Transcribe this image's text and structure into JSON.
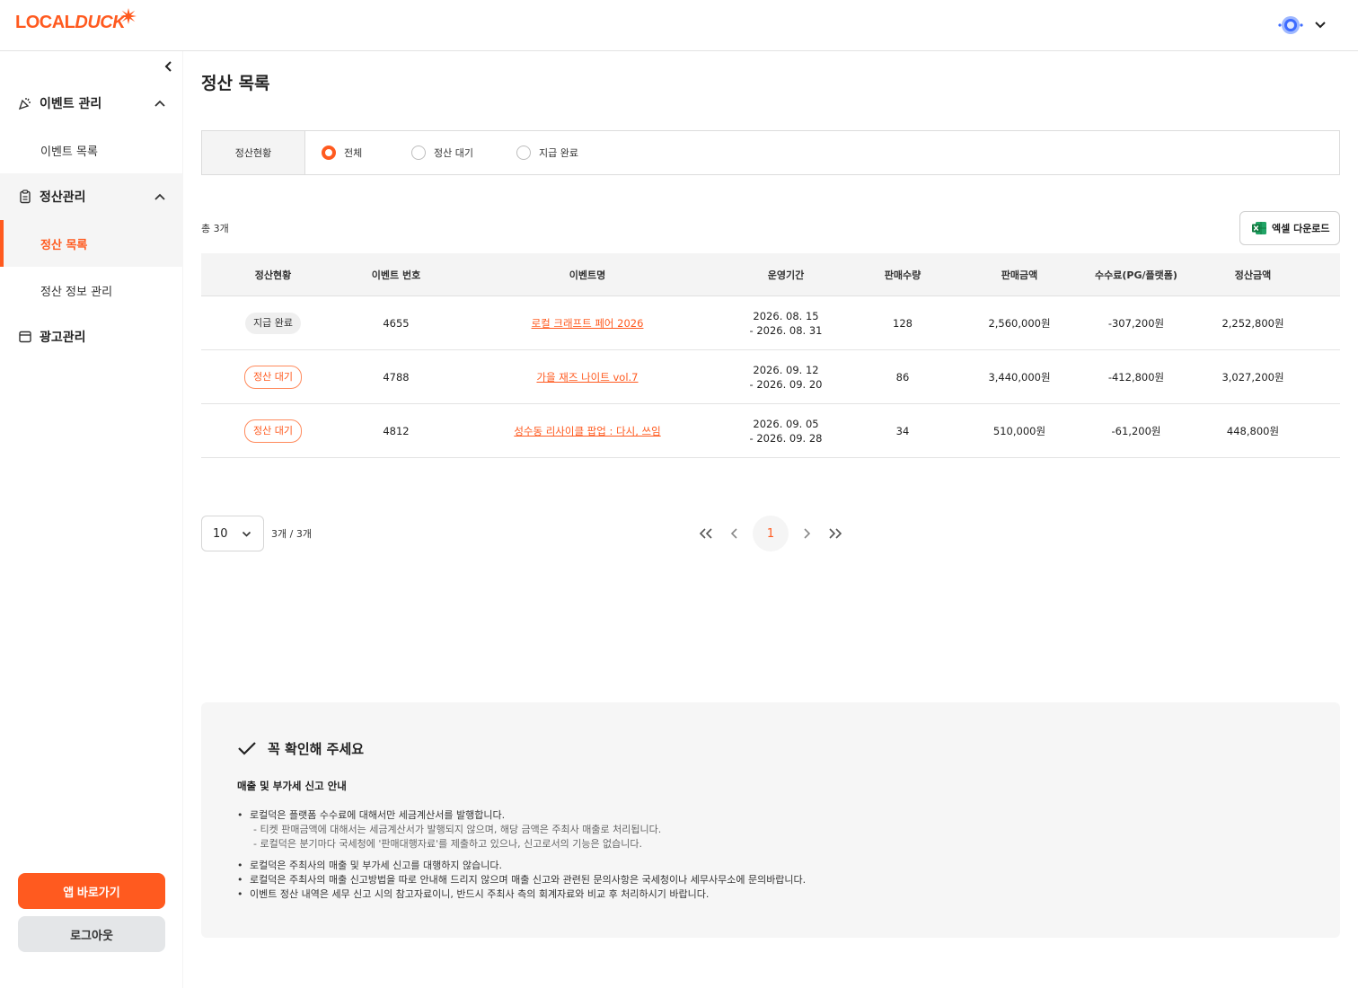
{
  "brand": {
    "logo_text_a": "LOCAL",
    "logo_text_b": "DUCK"
  },
  "sidebar": {
    "groups": [
      {
        "label": "이벤트 관리",
        "icon": "confetti-icon",
        "items": [
          {
            "label": "이벤트 목록"
          }
        ]
      },
      {
        "label": "정산관리",
        "icon": "clipboard-icon",
        "items": [
          {
            "label": "정산 목록",
            "active": true
          },
          {
            "label": "정산 정보 관리"
          }
        ]
      },
      {
        "label": "광고관리",
        "icon": "ad-window-icon",
        "items": []
      }
    ],
    "app_button": "앱 바로가기",
    "logout_button": "로그아웃"
  },
  "page": {
    "title": "정산 목록"
  },
  "filter": {
    "label": "정산현황",
    "options": [
      {
        "label": "전체",
        "checked": true
      },
      {
        "label": "정산 대기",
        "checked": false
      },
      {
        "label": "지급 완료",
        "checked": false
      }
    ]
  },
  "list": {
    "total": "총 3개",
    "excel_button": "엑셀 다운로드",
    "columns": [
      "정산현황",
      "이벤트 번호",
      "이벤트명",
      "운영기간",
      "판매수량",
      "판매금액",
      "수수료(PG/플랫폼)",
      "정산금액"
    ],
    "rows": [
      {
        "status": "지급 완료",
        "status_type": "done",
        "event_no": "4655",
        "event_name": "로컬 크래프트 페어 2026",
        "period_start": "2026. 08. 15",
        "period_end": "- 2026. 08. 31",
        "qty": "128",
        "sales": "2,560,000원",
        "fee": "-307,200원",
        "settle": "2,252,800원"
      },
      {
        "status": "정산 대기",
        "status_type": "wait",
        "event_no": "4788",
        "event_name": "가을 재즈 나이트 vol.7",
        "period_start": "2026. 09. 12",
        "period_end": "- 2026. 09. 20",
        "qty": "86",
        "sales": "3,440,000원",
        "fee": "-412,800원",
        "settle": "3,027,200원"
      },
      {
        "status": "정산 대기",
        "status_type": "wait",
        "event_no": "4812",
        "event_name": "성수동 리사이클 팝업 : 다시, 쓰임",
        "period_start": "2026. 09. 05",
        "period_end": "- 2026. 09. 28",
        "qty": "34",
        "sales": "510,000원",
        "fee": "-61,200원",
        "settle": "448,800원"
      }
    ]
  },
  "pagination": {
    "page_size": "10",
    "count_text": "3개 / 3개",
    "current_page": "1"
  },
  "notice": {
    "title": "꼭 확인해 주세요",
    "subtitle": "매출 및 부가세 신고 안내",
    "bullets": [
      {
        "text": "로컬덕은 플랫폼 수수료에 대해서만 세금계산서를 발행합니다.",
        "subs": [
          "- 티켓 판매금액에 대해서는 세금계산서가 발행되지 않으며, 해당 금액은 주최사 매출로 처리됩니다.",
          "- 로컬덕은 분기마다 국세청에 '판매대행자료'를 제출하고 있으나, 신고로서의 기능은 없습니다."
        ]
      },
      {
        "text": "로컬덕은 주최사의 매출 및 부가세 신고를 대행하지 않습니다.",
        "subs": []
      },
      {
        "text": "로컬덕은 주최사의 매출 신고방법을 따로 안내해 드리지 않으며 매출 신고와 관련된 문의사항은 국세청이나 세무사무소에 문의바랍니다.",
        "subs": []
      },
      {
        "text": "이벤트 정산 내역은 세무 신고 시의 참고자료이니, 반드시 주최사 측의 회계자료와 비교 후 처리하시기 바랍니다.",
        "subs": []
      }
    ]
  },
  "colors": {
    "accent": "#ff5a1f",
    "muted_bg": "#f4f4f4"
  }
}
